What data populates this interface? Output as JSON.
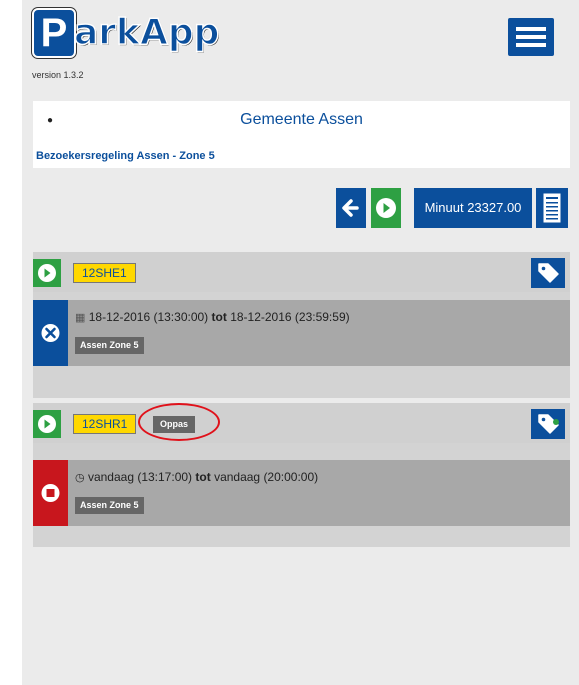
{
  "header": {
    "logo_letter": "P",
    "logo_text": "arkApp",
    "version": "version 1.3.2"
  },
  "municipality": {
    "name": "Gemeente Assen",
    "regulation": "Bezoekersregeling Assen - Zone 5"
  },
  "toolbar": {
    "minutes_label": "Minuut 23327.00"
  },
  "vehicles": [
    {
      "plate": "12SHE1",
      "session": {
        "start": "18-12-2016 (13:30:00)",
        "sep": "tot",
        "end": "18-12-2016 (23:59:59)",
        "zone": "Assen Zone 5"
      }
    },
    {
      "plate": "12SHR1",
      "badge": "Oppas",
      "session": {
        "start": "vandaag (13:17:00)",
        "sep": "tot",
        "end": "vandaag (20:00:00)",
        "zone": "Assen Zone 5"
      }
    }
  ],
  "colors": {
    "brand_blue": "#0b4f9c",
    "play_green": "#2ea043",
    "stop_red": "#c8161d",
    "plate_yellow": "#ffd800",
    "highlight_red": "#e0111a"
  },
  "icons": [
    "menu-icon",
    "arrow-left-icon",
    "play-icon",
    "notepad-icon",
    "tag-icon",
    "close-icon",
    "calendar-icon",
    "clock-icon",
    "stop-icon"
  ]
}
